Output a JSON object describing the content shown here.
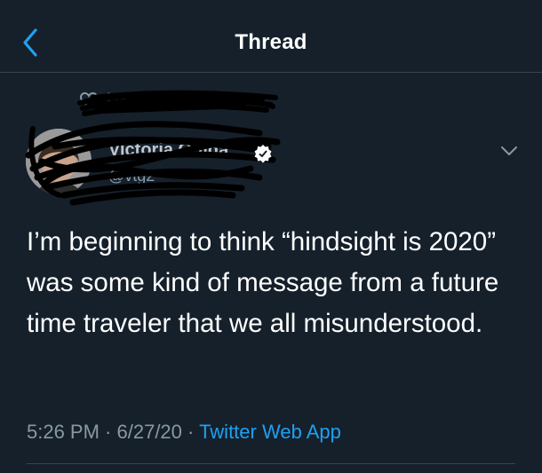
{
  "header": {
    "title": "Thread",
    "back_icon": "chevron-left-icon"
  },
  "social_context": {
    "text": "Haniu... liked",
    "icon": "heart-icon"
  },
  "author": {
    "display_name": "Victoria Guida",
    "handle": "@vtg2",
    "verified_icon": "verified-badge-icon"
  },
  "menu": {
    "icon": "chevron-down-icon"
  },
  "tweet": {
    "text": "I’m beginning to think “hindsight is 2020” was some kind of message from a future time traveler that we all misunderstood."
  },
  "meta": {
    "time": "5:26 PM",
    "separator": " · ",
    "date": "6/27/20",
    "source": "Twitter Web App"
  },
  "colors": {
    "background": "#15202b",
    "accent": "#1da1f2",
    "secondary_text": "#8899a6",
    "divider": "#38444d"
  }
}
